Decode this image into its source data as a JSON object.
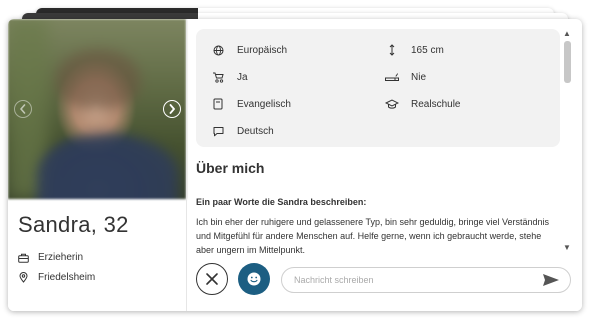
{
  "profile": {
    "name_age": "Sandra, 32",
    "occupation": "Erzieherin",
    "location": "Friedelsheim"
  },
  "attributes": [
    {
      "icon": "ethnicity-icon",
      "value": "Europäisch"
    },
    {
      "icon": "height-icon",
      "value": "165 cm"
    },
    {
      "icon": "stroller-icon",
      "value": "Ja"
    },
    {
      "icon": "smoking-icon",
      "value": "Nie"
    },
    {
      "icon": "religion-icon",
      "value": "Evangelisch"
    },
    {
      "icon": "education-icon",
      "value": "Realschule"
    },
    {
      "icon": "language-icon",
      "value": "Deutsch"
    }
  ],
  "about": {
    "title": "Über mich",
    "subtitle": "Ein paar Worte die Sandra beschreiben:",
    "text": "Ich bin eher der ruhigere und gelassenere Typ, bin sehr geduldig, bringe viel Verständnis und Mitgefühl für andere Menschen auf. Helfe gerne, wenn ich gebraucht werde, stehe aber ungern im Mittelpunkt."
  },
  "composer": {
    "placeholder": "Nachricht schreiben"
  },
  "colors": {
    "accent": "#1c5e82",
    "info_box_bg": "#f2f2f2"
  }
}
